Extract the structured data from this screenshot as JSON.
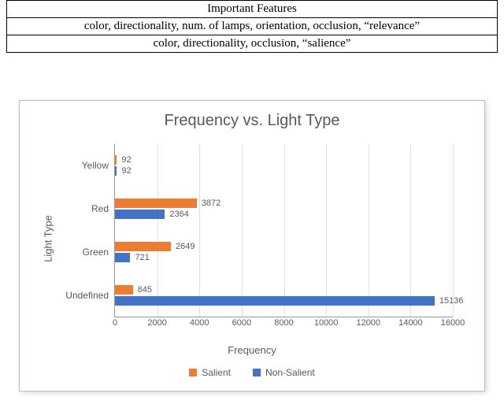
{
  "table": {
    "header": "Important Features",
    "rows": [
      "color, directionality, num. of lamps, orientation, occlusion, “relevance”",
      "color, directionality, occlusion, “salience”"
    ]
  },
  "chart_data": {
    "type": "bar",
    "orientation": "horizontal",
    "title": "Frequency vs. Light Type",
    "xlabel": "Frequency",
    "ylabel": "Light Type",
    "categories": [
      "Yellow",
      "Red",
      "Green",
      "Undefined"
    ],
    "series": [
      {
        "name": "Salient",
        "color": "#ED7D31",
        "values": [
          92,
          3872,
          2649,
          845
        ]
      },
      {
        "name": "Non-Salient",
        "color": "#4472C4",
        "values": [
          92,
          2364,
          721,
          15136
        ]
      }
    ],
    "xlim": [
      0,
      16000
    ],
    "xticks": [
      0,
      2000,
      4000,
      6000,
      8000,
      10000,
      12000,
      14000,
      16000
    ]
  }
}
